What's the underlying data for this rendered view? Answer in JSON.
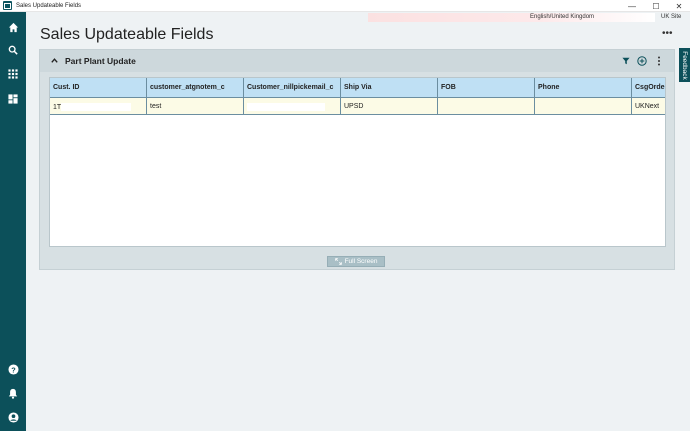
{
  "window": {
    "title": "Sales Updateable Fields",
    "controls": {
      "minimize": "—",
      "maximize": "☐",
      "close": "✕"
    }
  },
  "sidebar": {
    "items": [
      {
        "name": "home-icon"
      },
      {
        "name": "search-icon"
      },
      {
        "name": "apps-grid-icon"
      },
      {
        "name": "dashboard-icon"
      },
      {
        "name": "help-icon"
      },
      {
        "name": "bell-icon"
      },
      {
        "name": "user-icon"
      }
    ]
  },
  "header": {
    "locale": "English/United Kingdom",
    "site": "UK Site",
    "page_title": "Sales Updateable Fields",
    "more": "•••"
  },
  "feedback": {
    "label": "Feedback"
  },
  "panel": {
    "title": "Part Plant Update",
    "columns": [
      "Cust. ID",
      "customer_atgnotem_c",
      "Customer_nillpickemail_c",
      "Ship Via",
      "FOB",
      "Phone",
      "CsgOrderTyp"
    ],
    "rows": [
      [
        "1T",
        "test",
        "",
        "UPSD",
        "",
        "",
        "UKNext"
      ]
    ]
  },
  "fullscreen": {
    "label": "Full Screen"
  },
  "colors": {
    "sidebar": "#0c505a",
    "header_bg": "#bfe0f4",
    "row_bg": "#fcfbe6",
    "panel_bg": "#d7e0e3"
  }
}
